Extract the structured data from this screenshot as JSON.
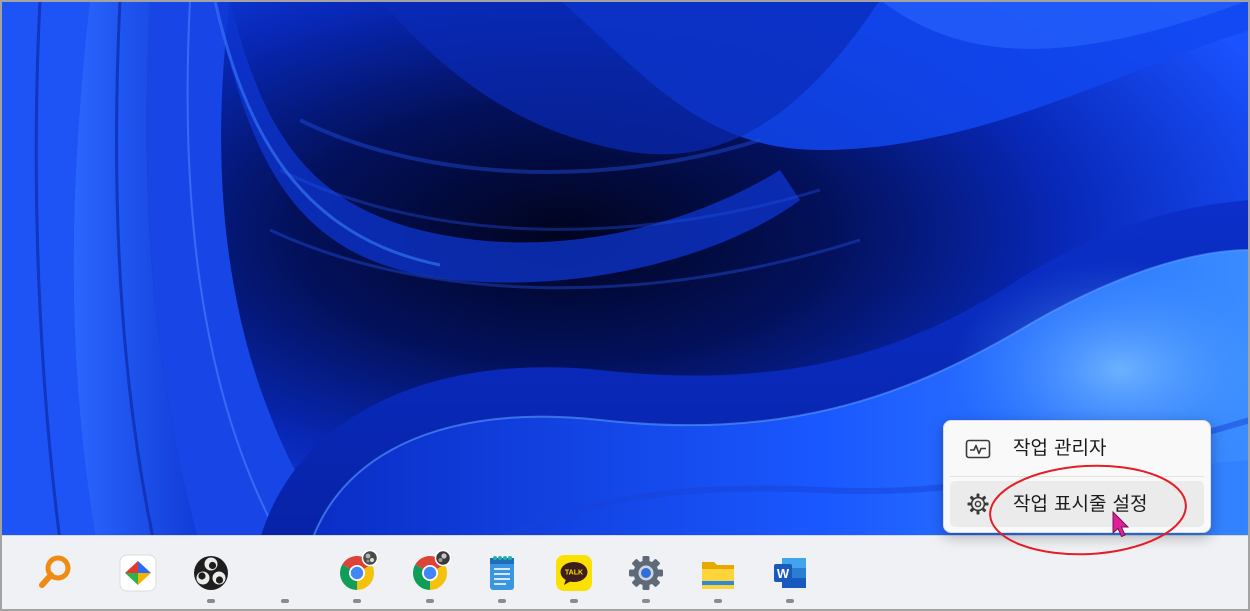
{
  "context_menu": {
    "items": [
      {
        "label": "작업 관리자",
        "icon": "task-manager-icon",
        "highlighted": false
      },
      {
        "label": "작업 표시줄 설정",
        "icon": "gear-icon",
        "highlighted": true
      }
    ]
  },
  "taskbar": {
    "items": [
      {
        "icon": "search-icon",
        "running": false
      },
      {
        "icon": "colorful-app-icon",
        "running": false
      },
      {
        "icon": "obs-icon",
        "running": true
      },
      {
        "icon": "blank-app-icon",
        "running": true
      },
      {
        "icon": "chrome-icon",
        "running": true,
        "profile_badge": true
      },
      {
        "icon": "chrome-icon",
        "running": true,
        "profile_badge": true
      },
      {
        "icon": "notepad-icon",
        "running": true
      },
      {
        "icon": "kakaotalk-icon",
        "running": true,
        "logo_text": "TALK"
      },
      {
        "icon": "settings-gear-icon",
        "running": true
      },
      {
        "icon": "file-explorer-icon",
        "running": true
      },
      {
        "icon": "word-icon",
        "running": true,
        "logo_text": "W"
      }
    ]
  },
  "colors": {
    "taskbar_bg": "#eff1f4",
    "menu_bg": "#f9f9f9",
    "menu_highlight": "#ebebeb",
    "annotation_ellipse": "#e41e26",
    "cursor": "#e0209a",
    "running_indicator": "#8b8b8b"
  }
}
